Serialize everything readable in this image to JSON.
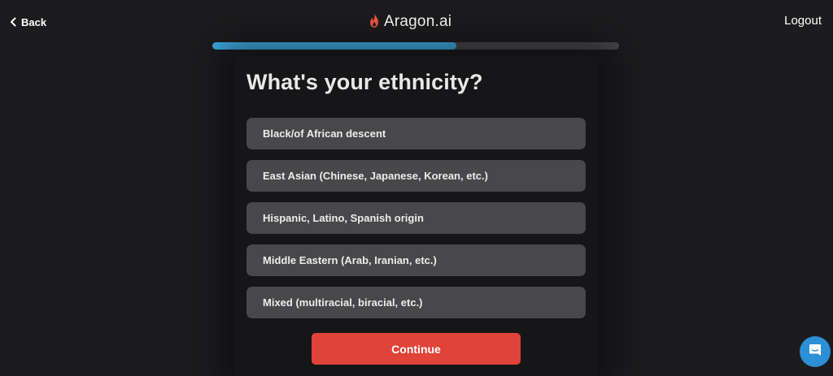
{
  "header": {
    "back_label": "Back",
    "brand_name": "Aragon.ai",
    "logout_label": "Logout"
  },
  "progress": {
    "fraction": 0.6,
    "fill_color": "#3fb6f0",
    "track_color": "#4a4a4d"
  },
  "question": {
    "title": "What's your ethnicity?"
  },
  "options": [
    {
      "label": "Black/of African descent"
    },
    {
      "label": "East Asian (Chinese, Japanese, Korean, etc.)"
    },
    {
      "label": "Hispanic, Latino, Spanish origin"
    },
    {
      "label": "Middle Eastern (Arab, Iranian, etc.)"
    },
    {
      "label": "Mixed (multiracial, biracial, etc.)"
    }
  ],
  "continue_label": "Continue",
  "icons": {
    "back": "chevron-left-icon",
    "brand": "flame-icon",
    "chat": "chat-bubble-icon"
  },
  "colors": {
    "accent": "#e04338",
    "brand_flame": "#f05a3c",
    "chat": "#2d8fd6",
    "background": "#1c1c1e",
    "option_bg": "#48484b"
  }
}
